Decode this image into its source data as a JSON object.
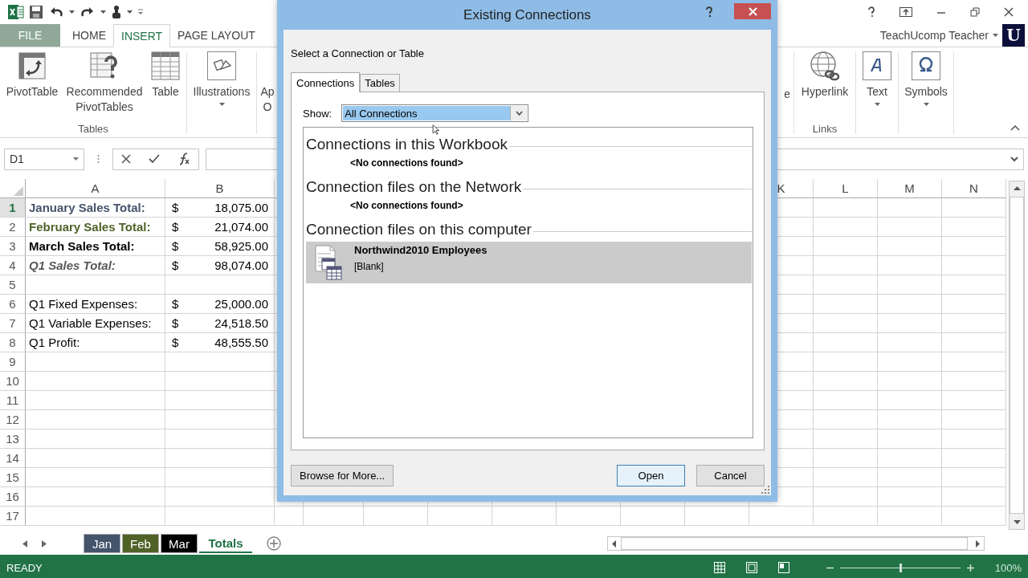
{
  "ribbon": {
    "tabs": [
      {
        "label": "FILE",
        "selected": false,
        "kind": "file"
      },
      {
        "label": "HOME",
        "selected": false,
        "kind": "tab"
      },
      {
        "label": "INSERT",
        "selected": true,
        "kind": "tab"
      },
      {
        "label": "PAGE LAYOUT",
        "selected": false,
        "kind": "tab"
      }
    ],
    "account": {
      "name": "TeachUcomp Teacher",
      "avatar": "U"
    },
    "left_groups": [
      {
        "label": "Tables",
        "commands": [
          {
            "label": "PivotTable",
            "kind": "pivot"
          },
          {
            "label": "Recommended PivotTables",
            "kind": "recommended"
          },
          {
            "label": "Table",
            "kind": "table"
          }
        ]
      },
      {
        "commands": [
          {
            "label": "Illustrations",
            "kind": "illustrations"
          }
        ]
      },
      {
        "commands": [
          {
            "label": "Ap O",
            "kind": "fragment"
          }
        ]
      }
    ],
    "right_fragment": "e",
    "right_groups": [
      {
        "label": "Links",
        "commands": [
          {
            "label": "Hyperlink",
            "kind": "hyperlink"
          }
        ]
      },
      {
        "commands": [
          {
            "label": "Text",
            "kind": "text"
          }
        ]
      },
      {
        "commands": [
          {
            "label": "Symbols",
            "kind": "symbols"
          }
        ]
      }
    ]
  },
  "formula_bar": {
    "name_box": "D1"
  },
  "sheet": {
    "columns_left": [
      "A",
      "B"
    ],
    "columns_right": [
      "K",
      "L",
      "M",
      "N"
    ],
    "rows": [
      {
        "number": "1",
        "selected": true,
        "label": "January Sales Total:",
        "kind": "total",
        "color": "#44546a",
        "currency": "$",
        "amount": "18,075.00"
      },
      {
        "number": "2",
        "selected": false,
        "label": "February Sales Total:",
        "kind": "total",
        "color": "#4f6228",
        "currency": "$",
        "amount": "21,074.00"
      },
      {
        "number": "3",
        "selected": false,
        "label": "March Sales Total:",
        "kind": "total",
        "color": "#000000",
        "currency": "$",
        "amount": "58,925.00"
      },
      {
        "number": "4",
        "selected": false,
        "label": "Q1 Sales Total:",
        "kind": "grand-total",
        "color": "#595959",
        "currency": "$",
        "amount": "98,074.00"
      },
      {
        "number": "5",
        "selected": false
      },
      {
        "number": "6",
        "selected": false,
        "label": "Q1 Fixed Expenses:",
        "kind": "detail",
        "color": "#000000",
        "currency": "$",
        "amount": "25,000.00"
      },
      {
        "number": "7",
        "selected": false,
        "label": "Q1 Variable Expenses:",
        "kind": "detail",
        "color": "#000000",
        "currency": "$",
        "amount": "24,518.50"
      },
      {
        "number": "8",
        "selected": false,
        "label": "Q1 Profit:",
        "kind": "detail",
        "color": "#000000",
        "currency": "$",
        "amount": "48,555.50"
      },
      {
        "number": "9",
        "selected": false
      },
      {
        "number": "10",
        "selected": false
      },
      {
        "number": "11",
        "selected": false
      },
      {
        "number": "12",
        "selected": false
      },
      {
        "number": "13",
        "selected": false
      },
      {
        "number": "14",
        "selected": false
      },
      {
        "number": "15",
        "selected": false
      },
      {
        "number": "16",
        "selected": false
      },
      {
        "number": "17",
        "selected": false
      }
    ]
  },
  "sheet_tabs": [
    {
      "label": "Jan",
      "color": "#44546a",
      "selected": false
    },
    {
      "label": "Feb",
      "color": "#4f6228",
      "selected": false
    },
    {
      "label": "Mar",
      "color": "#000000",
      "selected": false
    },
    {
      "label": "Totals",
      "selected": true
    }
  ],
  "status_bar": {
    "text": "READY",
    "zoom": "100%",
    "level": 0.5
  },
  "dialog": {
    "title": "Existing Connections",
    "prompt": "Select a Connection or Table",
    "tabs": [
      {
        "label": "Connections",
        "selected": true
      },
      {
        "label": "Tables",
        "selected": false
      }
    ],
    "show_label": "Show:",
    "show_value": "All Connections",
    "sections": [
      {
        "heading": "Connections in this Workbook",
        "empty_text": "<No connections found>"
      },
      {
        "heading": "Connection files on the Network",
        "empty_text": "<No connections found>"
      },
      {
        "heading": "Connection files on this computer",
        "items": [
          {
            "name": "Northwind2010 Employees",
            "description": "[Blank]",
            "selected": true
          }
        ]
      }
    ],
    "buttons": [
      {
        "label": "Browse for More...",
        "kind": "left",
        "default": false
      },
      {
        "label": "Open",
        "kind": "right",
        "default": true
      },
      {
        "label": "Cancel",
        "kind": "right",
        "default": false
      }
    ]
  }
}
